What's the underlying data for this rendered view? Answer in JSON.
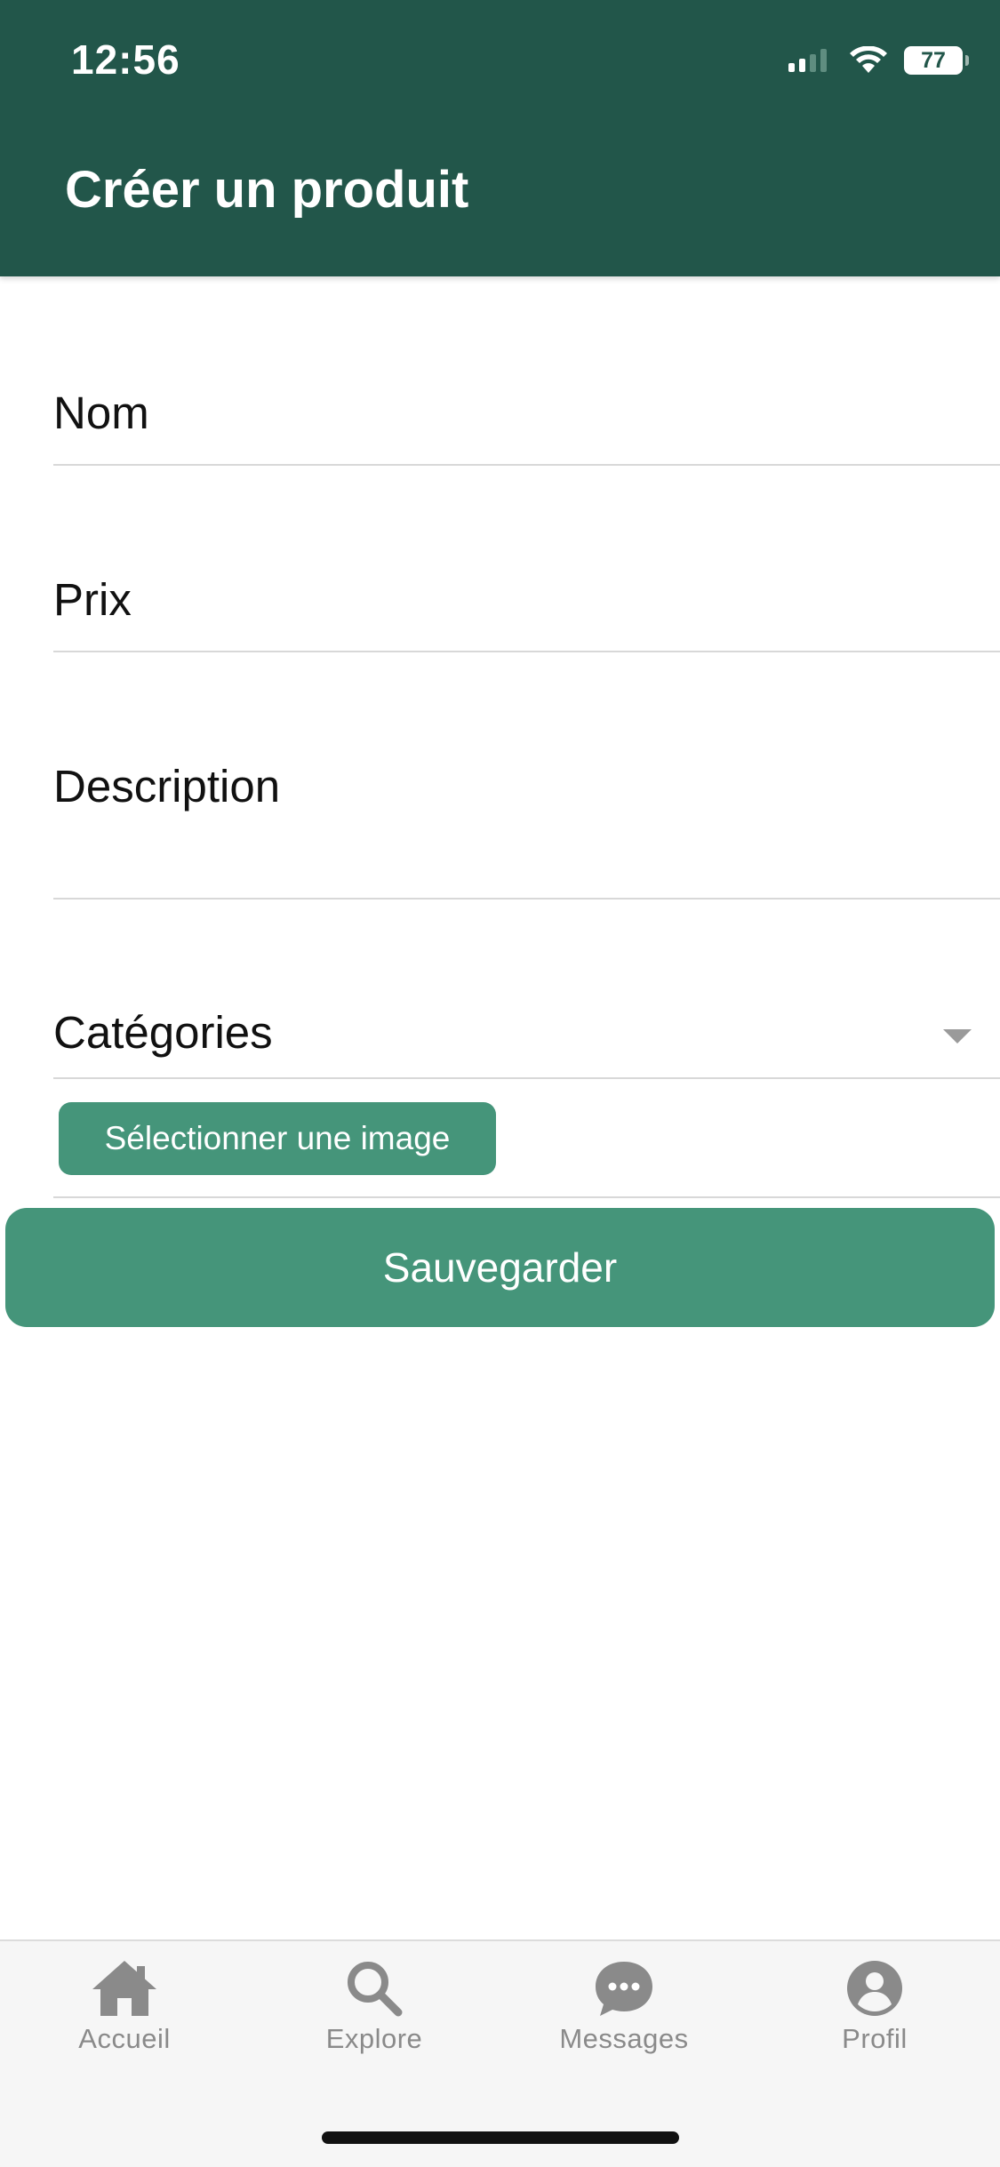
{
  "status_bar": {
    "time": "12:56",
    "battery": "77"
  },
  "header": {
    "title": "Créer un produit"
  },
  "form": {
    "name_label": "Nom",
    "price_label": "Prix",
    "description_label": "Description",
    "categories_label": "Catégories",
    "select_image_label": "Sélectionner une image",
    "save_label": "Sauvegarder"
  },
  "tabbar": {
    "items": [
      {
        "label": "Accueil",
        "icon": "home-icon"
      },
      {
        "label": "Explore",
        "icon": "search-icon"
      },
      {
        "label": "Messages",
        "icon": "chat-bubble-icon"
      },
      {
        "label": "Profil",
        "icon": "user-icon"
      }
    ]
  },
  "colors": {
    "header": "#22564a",
    "accent": "#45957a",
    "tab_inactive": "#8a8a8a"
  }
}
